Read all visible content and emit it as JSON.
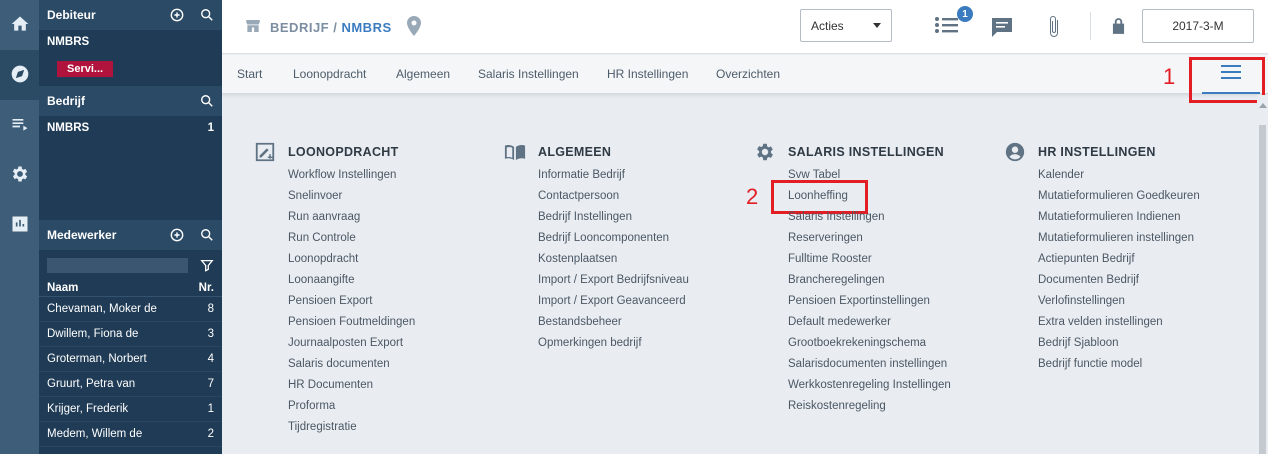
{
  "side": {
    "debiteur": {
      "title": "Debiteur",
      "name": "NMBRS",
      "badge": "Servi..."
    },
    "bedrijf": {
      "title": "Bedrijf",
      "name": "NMBRS",
      "count": "1"
    },
    "medewerker": {
      "title": "Medewerker",
      "col_name": "Naam",
      "col_nr": "Nr.",
      "rows": [
        {
          "name": "Chevaman, Moker de",
          "nr": "8"
        },
        {
          "name": "Dwillem, Fiona de",
          "nr": "3"
        },
        {
          "name": "Groterman, Norbert",
          "nr": "4"
        },
        {
          "name": "Gruurt, Petra van",
          "nr": "7"
        },
        {
          "name": "Krijger, Frederik",
          "nr": "1"
        },
        {
          "name": "Medem, Willem de",
          "nr": "2"
        }
      ]
    }
  },
  "topbar": {
    "crumb_prefix": "BEDRIJF / ",
    "crumb_current": "NMBRS",
    "acties": "Acties",
    "notif_count": "1",
    "period": "2017-3-M"
  },
  "tabs": [
    "Start",
    "Loonopdracht",
    "Algemeen",
    "Salaris Instellingen",
    "HR Instellingen",
    "Overzichten"
  ],
  "annotations": {
    "one": "1",
    "two": "2"
  },
  "columns": [
    {
      "title": "LOONOPDRACHT",
      "icon": "edit-square-icon",
      "links": [
        "Workflow Instellingen",
        "Snelinvoer",
        "Run aanvraag",
        "Run Controle",
        "Loonopdracht",
        "Loonaangifte",
        "Pensioen Export",
        "Pensioen Foutmeldingen",
        "Journaalposten Export",
        "Salaris documenten",
        "HR Documenten",
        "Proforma",
        "Tijdregistratie"
      ]
    },
    {
      "title": "ALGEMEEN",
      "icon": "book-icon",
      "links": [
        "Informatie Bedrijf",
        "Contactpersoon",
        "Bedrijf Instellingen",
        "Bedrijf Looncomponenten",
        "Kostenplaatsen",
        "Import / Export Bedrijfsniveau",
        "Import / Export Geavanceerd",
        "Bestandsbeheer",
        "Opmerkingen bedrijf"
      ]
    },
    {
      "title": "SALARIS INSTELLINGEN",
      "icon": "gear-icon",
      "links": [
        "Svw Tabel",
        "Loonheffing",
        "Salaris Instellingen",
        "Reserveringen",
        "Fulltime Rooster",
        "Brancheregelingen",
        "Pensioen Exportinstellingen",
        "Default medewerker",
        "Grootboekrekeningschema",
        "Salarisdocumenten instellingen",
        "Werkkostenregeling Instellingen",
        "Reiskostenregeling"
      ]
    },
    {
      "title": "HR INSTELLINGEN",
      "icon": "user-circle-icon",
      "links": [
        "Kalender",
        "Mutatieformulieren Goedkeuren",
        "Mutatieformulieren Indienen",
        "Mutatieformulieren instellingen",
        "Actiepunten Bedrijf",
        "Documenten Bedrijf",
        "Verlofinstellingen",
        "Extra velden instellingen",
        "Bedrijf Sjabloon",
        "Bedrijf functie model"
      ]
    }
  ]
}
